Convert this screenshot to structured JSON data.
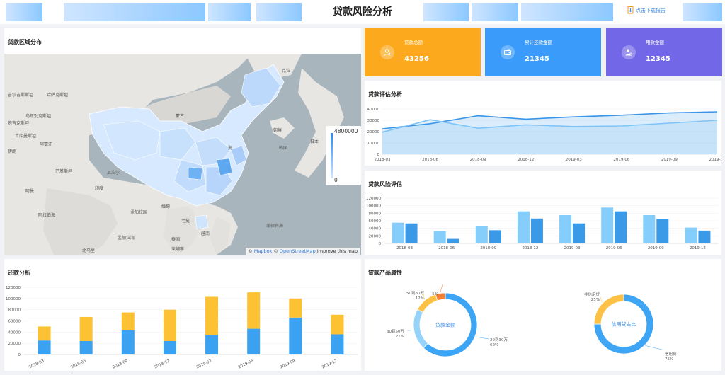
{
  "header": {
    "title": "贷款风险分析",
    "download_label": "点击下载报告"
  },
  "map": {
    "title": "贷款区域分布",
    "legend_max": "4800000",
    "legend_min": "0",
    "attribution": {
      "prefix": "©",
      "mapbox": "Mapbox",
      "osm": "OpenStreetMap",
      "improve": "Improve this map"
    },
    "places": [
      "克拉",
      "哈萨克斯坦",
      "乌兹别克斯坦",
      "土库曼斯坦",
      "阿富汗",
      "巴基斯坦",
      "伊朗",
      "阿曼",
      "印度",
      "孟加拉国",
      "阿拉伯海",
      "孟加拉湾",
      "缅甸",
      "泰国",
      "老挝",
      "越南",
      "蒙古",
      "朝鲜",
      "韩国",
      "日本",
      "菲律宾海",
      "北马里",
      "柬埔寨",
      "尼泊尔",
      "吉尔吉斯斯坦",
      "塔吉克斯坦",
      "海"
    ]
  },
  "kpis": [
    {
      "label": "贷款总额",
      "value": "43256",
      "color": "#fda91e",
      "icon": "money-bag-icon"
    },
    {
      "label": "累计还款金额",
      "value": "21345",
      "color": "#3b9bfa",
      "icon": "wallet-icon"
    },
    {
      "label": "用款金额",
      "value": "12345",
      "color": "#7267e6",
      "icon": "user-money-icon"
    }
  ],
  "panels": {
    "assessment_title": "贷款评估分析",
    "risk_title": "贷款风险评估",
    "repay_title": "还款分析",
    "product_title": "贷款产品属性"
  },
  "chart_data": [
    {
      "type": "area",
      "title": "贷款评估分析",
      "categories": [
        "2018-03",
        "2018-06",
        "2018-09",
        "2018-12",
        "2019-03",
        "2019-06",
        "2019-09",
        "2019-12"
      ],
      "series": [
        {
          "values": [
            22500,
            27000,
            34000,
            31000,
            33000,
            34500,
            36500,
            37500
          ],
          "color": "#3a94e8"
        },
        {
          "values": [
            19500,
            30500,
            23000,
            26000,
            24500,
            25000,
            27500,
            30000
          ],
          "color": "#7fc4f7"
        }
      ],
      "ylim": [
        0,
        40000
      ],
      "yticks": [
        0,
        10000,
        20000,
        30000,
        40000
      ]
    },
    {
      "type": "bar",
      "title": "贷款风险评估",
      "categories": [
        "2018-03",
        "2018-06",
        "2018-09",
        "2018-12",
        "2019-03",
        "2019-06",
        "2019-09",
        "2019-12"
      ],
      "series": [
        {
          "values": [
            55000,
            33000,
            45000,
            85000,
            75000,
            95000,
            75000,
            42000
          ],
          "color": "#85cdfb"
        },
        {
          "values": [
            53000,
            12000,
            35000,
            66000,
            53000,
            85000,
            65000,
            34000
          ],
          "color": "#3a9ae8"
        }
      ],
      "ylim": [
        0,
        120000
      ],
      "yticks": [
        0,
        20000,
        40000,
        60000,
        80000,
        100000,
        120000
      ]
    },
    {
      "type": "bar",
      "title": "还款分析",
      "stacked": true,
      "categories": [
        "2018-03",
        "2018-06",
        "2018-09",
        "2018-12",
        "2019-03",
        "2019-06",
        "2019-09",
        "2019-12"
      ],
      "series": [
        {
          "values": [
            25000,
            24000,
            43000,
            24000,
            35000,
            46000,
            66000,
            36000
          ],
          "color": "#3aa2f0"
        },
        {
          "values": [
            25000,
            43000,
            32000,
            56000,
            68000,
            65000,
            34000,
            35000
          ],
          "color": "#fdc233"
        }
      ],
      "ylim": [
        0,
        120000
      ],
      "yticks": [
        0,
        20000,
        40000,
        60000,
        80000,
        100000,
        120000
      ]
    },
    {
      "type": "pie",
      "title": "贷款金额",
      "slices": [
        {
          "name": "20到30万",
          "value": 62,
          "label": "62%",
          "color": "#3ea4f4"
        },
        {
          "name": "30到50万",
          "value": 21,
          "label": "21%",
          "color": "#96d3fb"
        },
        {
          "name": "50到80万",
          "value": 12,
          "label": "12%",
          "color": "#fdc146"
        },
        {
          "name": "",
          "value": 5,
          "label": "5%",
          "color": "#f28135"
        }
      ]
    },
    {
      "type": "pie",
      "title": "信用贷占比",
      "slices": [
        {
          "name": "信用贷",
          "value": 75,
          "label": "75%",
          "color": "#3ea4f4"
        },
        {
          "name": "非信用贷",
          "value": 25,
          "label": "25%",
          "color": "#fdc146"
        }
      ]
    }
  ]
}
